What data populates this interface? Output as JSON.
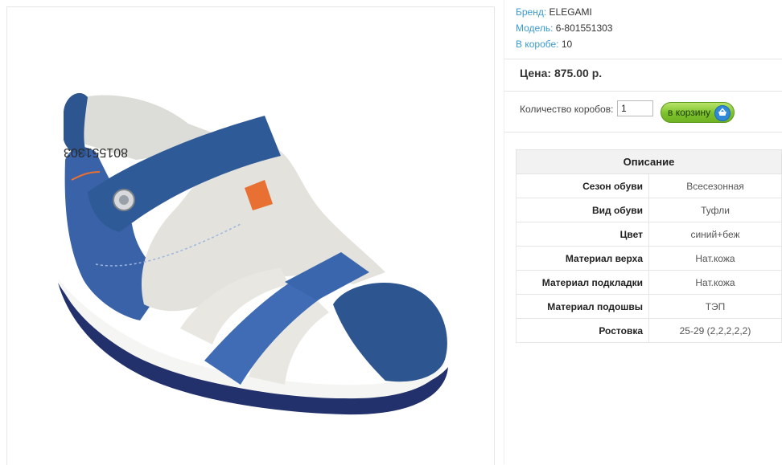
{
  "product_info": {
    "brand_label": "Бренд:",
    "brand_value": "ELEGAMI",
    "model_label": "Модель:",
    "model_value": "6-801551303",
    "box_label": "В коробе:",
    "box_value": "10"
  },
  "price": {
    "text": "Цена: 875.00 р."
  },
  "order": {
    "quantity_label": "Количество коробов:",
    "quantity_value": "1",
    "add_to_cart_label": "в корзину"
  },
  "description": {
    "title": "Описание",
    "rows": [
      {
        "label": "Сезон обуви",
        "value": "Всесезонная"
      },
      {
        "label": "Вид обуви",
        "value": "Туфли"
      },
      {
        "label": "Цвет",
        "value": "синий+беж"
      },
      {
        "label": "Материал верха",
        "value": "Нат.кожа"
      },
      {
        "label": "Материал подкладки",
        "value": "Нат.кожа"
      },
      {
        "label": "Материал подошвы",
        "value": "ТЭП"
      },
      {
        "label": "Ростовка",
        "value": "25-29 (2,2,2,2,2)"
      }
    ]
  },
  "image": {
    "sole_print": "801551303"
  },
  "colors": {
    "link_label": "#3a9bd0",
    "button_green": "#7cc22c",
    "cart_icon_blue": "#2f89d8",
    "shoe_navy": "#2d5590",
    "shoe_cream": "#e4e2dd"
  }
}
